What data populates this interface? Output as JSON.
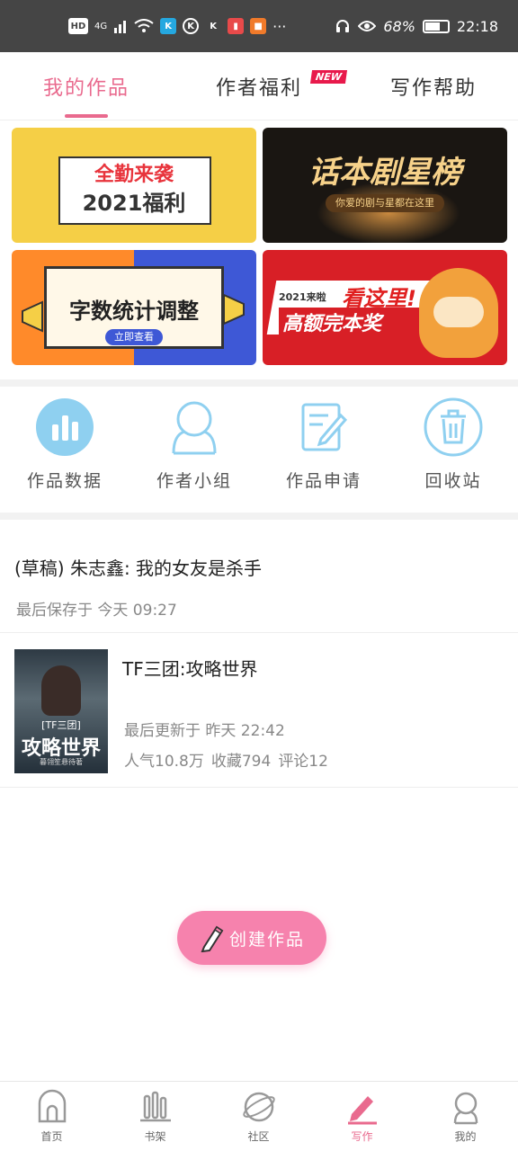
{
  "status_bar": {
    "network": "HD",
    "signal": "4G",
    "battery": "68%",
    "battery_level": 0.68,
    "time": "22:18",
    "more": "···"
  },
  "tabs": [
    {
      "label": "我的作品",
      "active": true
    },
    {
      "label": "作者福利",
      "badge": "NEW"
    },
    {
      "label": "写作帮助"
    }
  ],
  "banners": {
    "attendance": {
      "line1": "全勤来袭",
      "line2": "2021福利"
    },
    "drama": {
      "title": "话本剧星榜",
      "subtitle": "你爱的剧与星都在这里"
    },
    "word_count": {
      "title": "字数统计调整",
      "button": "立即查看"
    },
    "completion": {
      "tag": "2021来啦",
      "headline": "看这里!",
      "title": "高额完本奖"
    }
  },
  "actions": [
    {
      "label": "作品数据",
      "icon": "bar-chart-icon"
    },
    {
      "label": "作者小组",
      "icon": "group-icon"
    },
    {
      "label": "作品申请",
      "icon": "edit-document-icon"
    },
    {
      "label": "回收站",
      "icon": "trash-icon"
    }
  ],
  "draft": {
    "title": "(草稿) 朱志鑫: 我的女友是杀手",
    "saved": "最后保存于 今天 09:27"
  },
  "work": {
    "title": "TF三团:攻略世界",
    "updated": "最后更新于 昨天 22:42",
    "popularity": "人气10.8万",
    "favorites": "收藏794",
    "comments": "评论12",
    "cover": {
      "tag": "[TF三团]",
      "title": "攻略世界",
      "author": "暮翎笙悬待著"
    }
  },
  "create_button": "创建作品",
  "colors": {
    "accent": "#e96a8e",
    "create": "#f682ad",
    "icon_blue": "#8fd0f0"
  },
  "bottom_nav": [
    {
      "label": "首页",
      "icon": "home-icon"
    },
    {
      "label": "书架",
      "icon": "bookshelf-icon"
    },
    {
      "label": "社区",
      "icon": "community-planet-icon"
    },
    {
      "label": "写作",
      "icon": "pen-icon",
      "active": true
    },
    {
      "label": "我的",
      "icon": "profile-icon"
    }
  ]
}
